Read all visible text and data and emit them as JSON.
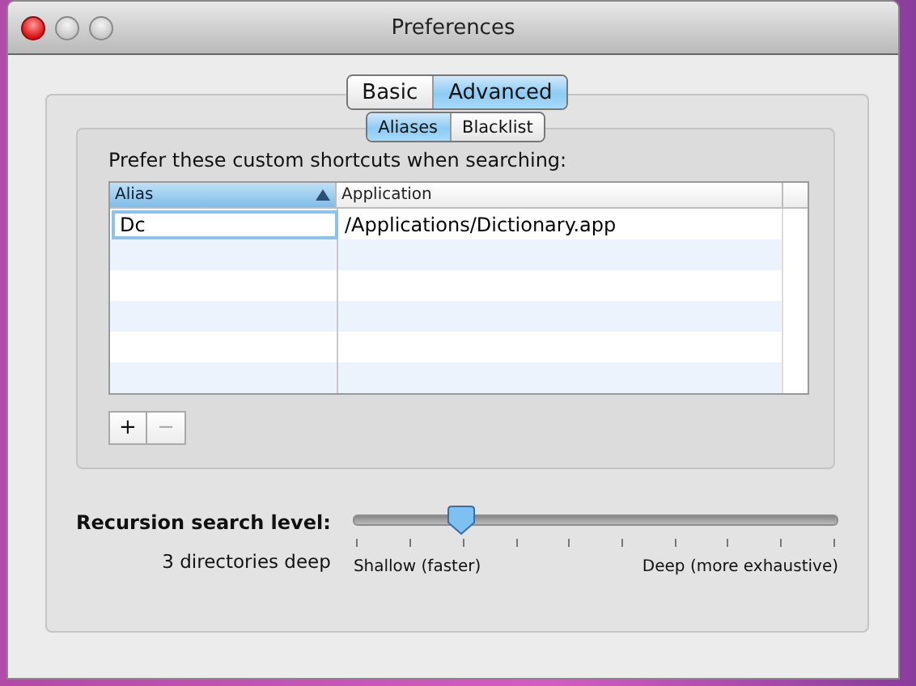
{
  "window": {
    "title": "Preferences"
  },
  "tabs": [
    {
      "label": "Basic",
      "selected": false
    },
    {
      "label": "Advanced",
      "selected": true
    }
  ],
  "subtabs": [
    {
      "label": "Aliases",
      "selected": true
    },
    {
      "label": "Blacklist",
      "selected": false
    }
  ],
  "aliases": {
    "prompt": "Prefer these custom shortcuts when searching:",
    "columns": [
      {
        "label": "Alias",
        "selected": true
      },
      {
        "label": "Application",
        "selected": false
      }
    ],
    "rows": [
      {
        "alias": "Dc",
        "application": "/Applications/Dictionary.app",
        "editing": true
      }
    ],
    "add_button": "+",
    "remove_button": {
      "label": "−",
      "disabled": true
    }
  },
  "recursion": {
    "label": "Recursion search level:",
    "reading": "3 directories deep",
    "level": 0.222,
    "min_label": "Shallow (faster)",
    "max_label": "Deep (more exhaustive)"
  }
}
